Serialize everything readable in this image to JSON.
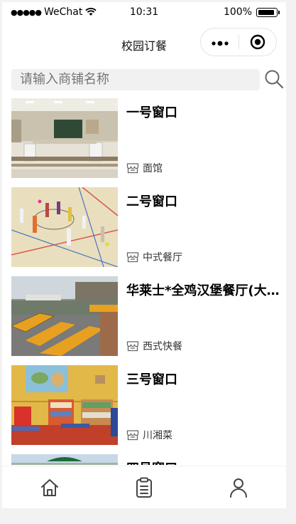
{
  "status_bar": {
    "carrier": "WeChat",
    "time": "10:31",
    "battery": "100%"
  },
  "nav": {
    "title": "校园订餐",
    "more_icon": "more-dots-icon",
    "close_icon": "target-close-icon"
  },
  "search": {
    "placeholder": "请输入商铺名称",
    "icon": "search-icon"
  },
  "shops": [
    {
      "name": "一号窗口",
      "category": "面馆"
    },
    {
      "name": "二号窗口",
      "category": "中式餐厅"
    },
    {
      "name": "华莱士*全鸡汉堡餐厅(大学城店)",
      "category": "西式快餐"
    },
    {
      "name": "三号窗口",
      "category": "川湘菜"
    },
    {
      "name": "四号窗口",
      "category": ""
    }
  ],
  "tabbar": {
    "items": [
      "home-icon",
      "clipboard-icon",
      "user-icon"
    ]
  },
  "colors": {
    "background": "#ffffff",
    "search_bg": "#f1f1f1",
    "text": "#000000",
    "subtext": "#333333"
  }
}
